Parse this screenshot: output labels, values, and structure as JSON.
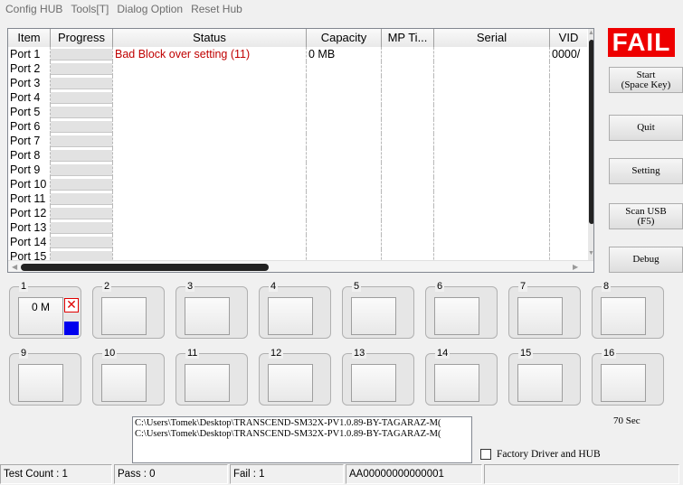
{
  "menu": [
    "Config HUB",
    "Tools[T]",
    "Dialog Option",
    "Reset Hub"
  ],
  "grid": {
    "columns": [
      "Item",
      "Progress",
      "Status",
      "Capacity",
      "MP Ti...",
      "Serial",
      "VID"
    ],
    "rows": [
      {
        "item": "Port 1",
        "status": "Bad Block over setting (11)",
        "capacity": "0 MB",
        "mp_time": "",
        "serial": "",
        "vid": "0000/"
      },
      {
        "item": "Port 2",
        "status": "",
        "capacity": "",
        "mp_time": "",
        "serial": "",
        "vid": ""
      },
      {
        "item": "Port 3",
        "status": "",
        "capacity": "",
        "mp_time": "",
        "serial": "",
        "vid": ""
      },
      {
        "item": "Port 4",
        "status": "",
        "capacity": "",
        "mp_time": "",
        "serial": "",
        "vid": ""
      },
      {
        "item": "Port 5",
        "status": "",
        "capacity": "",
        "mp_time": "",
        "serial": "",
        "vid": ""
      },
      {
        "item": "Port 6",
        "status": "",
        "capacity": "",
        "mp_time": "",
        "serial": "",
        "vid": ""
      },
      {
        "item": "Port 7",
        "status": "",
        "capacity": "",
        "mp_time": "",
        "serial": "",
        "vid": ""
      },
      {
        "item": "Port 8",
        "status": "",
        "capacity": "",
        "mp_time": "",
        "serial": "",
        "vid": ""
      },
      {
        "item": "Port 9",
        "status": "",
        "capacity": "",
        "mp_time": "",
        "serial": "",
        "vid": ""
      },
      {
        "item": "Port 10",
        "status": "",
        "capacity": "",
        "mp_time": "",
        "serial": "",
        "vid": ""
      },
      {
        "item": "Port 11",
        "status": "",
        "capacity": "",
        "mp_time": "",
        "serial": "",
        "vid": ""
      },
      {
        "item": "Port 12",
        "status": "",
        "capacity": "",
        "mp_time": "",
        "serial": "",
        "vid": ""
      },
      {
        "item": "Port 13",
        "status": "",
        "capacity": "",
        "mp_time": "",
        "serial": "",
        "vid": ""
      },
      {
        "item": "Port 14",
        "status": "",
        "capacity": "",
        "mp_time": "",
        "serial": "",
        "vid": ""
      },
      {
        "item": "Port 15",
        "status": "",
        "capacity": "",
        "mp_time": "",
        "serial": "",
        "vid": ""
      }
    ]
  },
  "result": {
    "label": "FAIL",
    "color": "#ee0000"
  },
  "buttons": {
    "start": "Start\n(Space Key)",
    "quit": "Quit",
    "setting": "Setting",
    "scan": "Scan USB\n(F5)",
    "debug": "Debug"
  },
  "slots": [
    {
      "num": "1",
      "label": "0 M",
      "fail": true
    },
    {
      "num": "2",
      "label": ""
    },
    {
      "num": "3",
      "label": ""
    },
    {
      "num": "4",
      "label": ""
    },
    {
      "num": "5",
      "label": ""
    },
    {
      "num": "6",
      "label": ""
    },
    {
      "num": "7",
      "label": ""
    },
    {
      "num": "8",
      "label": ""
    },
    {
      "num": "9",
      "label": ""
    },
    {
      "num": "10",
      "label": ""
    },
    {
      "num": "11",
      "label": ""
    },
    {
      "num": "12",
      "label": ""
    },
    {
      "num": "13",
      "label": ""
    },
    {
      "num": "14",
      "label": ""
    },
    {
      "num": "15",
      "label": ""
    },
    {
      "num": "16",
      "label": ""
    }
  ],
  "slot_fail_mark": "✕",
  "log": [
    "C:\\Users\\Tomek\\Desktop\\TRANSCEND-SM32X-PV1.0.89-BY-TAGARAZ-M(",
    "C:\\Users\\Tomek\\Desktop\\TRANSCEND-SM32X-PV1.0.89-BY-TAGARAZ-M("
  ],
  "elapsed": "70 Sec",
  "factory_label": "Factory Driver and HUB",
  "factory_checked": false,
  "status": {
    "test_count": "Test Count : 1",
    "pass": "Pass : 0",
    "fail": "Fail : 1",
    "id": "AA00000000000001",
    "extra": ""
  }
}
